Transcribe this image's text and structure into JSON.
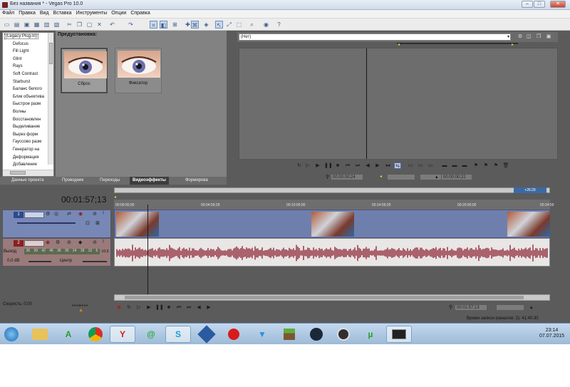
{
  "window": {
    "title": "Без названия * - Vegas Pro 10.0",
    "btn_min": "–",
    "btn_max": "□",
    "btn_close": "✕"
  },
  "menu": [
    "Файл",
    "Правка",
    "Вид",
    "Вставка",
    "Инструменты",
    "Опции",
    "Справка"
  ],
  "plugins": {
    "items": [
      "(Legacy Plug-In)",
      "Defocus",
      "Fill Light",
      "Glint",
      "Rays",
      "Soft Contrast",
      "Starburst",
      "Баланс белого",
      "Блик объектива",
      "Быстрое разм",
      "Волны",
      "Восстановлен",
      "Выделивание",
      "Вырез форм",
      "Гауссово разм",
      "Генератор на",
      "Деформация",
      "Добавление"
    ],
    "selected_index": 0
  },
  "presets": {
    "label": "Предустановка:",
    "items": [
      {
        "caption": "Сброс",
        "selected": true
      },
      {
        "caption": "Фиксатор",
        "selected": false
      }
    ]
  },
  "tabs": [
    "Данные проекта",
    "Проводник",
    "Переходы",
    "Видеоэффекты",
    "Формирова"
  ],
  "active_tab": "Видеоэффекты",
  "preview": {
    "select_value": "(Нет)",
    "timecode": "00:00:00;24",
    "field_values": [
      "",
      "",
      "00:00:00;22"
    ]
  },
  "timeline": {
    "timecode": "00:01:57;13",
    "ruler_labels": [
      "00:00:00;00",
      "00:04:59;29",
      "00:10:00;00",
      "00:14:59;29",
      "00:20:00;00",
      "00:24:59"
    ],
    "end_marker": "+26:29",
    "track1_num": "1",
    "track2_num": "2",
    "audio_vol_label": "Выход",
    "audio_vol_value": "0,0 dB",
    "audio_pan_label": "Центр",
    "meter_scale": [
      "36",
      "39",
      "42",
      "45",
      "36",
      "30",
      "24",
      "18",
      "12",
      "6"
    ],
    "meter_side": "-10,9",
    "speed_label": "Скорость: 0,00",
    "bottom_time": "00:01:57;13",
    "record_info": "Время записи (каналов: 2): 41:40:30"
  },
  "taskbar": {
    "time": "23:14",
    "date": "07.07.2015"
  },
  "icons": [
    "start-orb-icon",
    "folder-icon",
    "app-a-icon",
    "chrome-icon",
    "yandex-icon",
    "at-mail-icon",
    "skype-icon",
    "virtualbox-icon",
    "record-dot-icon",
    "lamp-icon",
    "minecraft-icon",
    "steam-icon",
    "obs-icon",
    "utorrent-icon",
    "terminal-icon"
  ]
}
